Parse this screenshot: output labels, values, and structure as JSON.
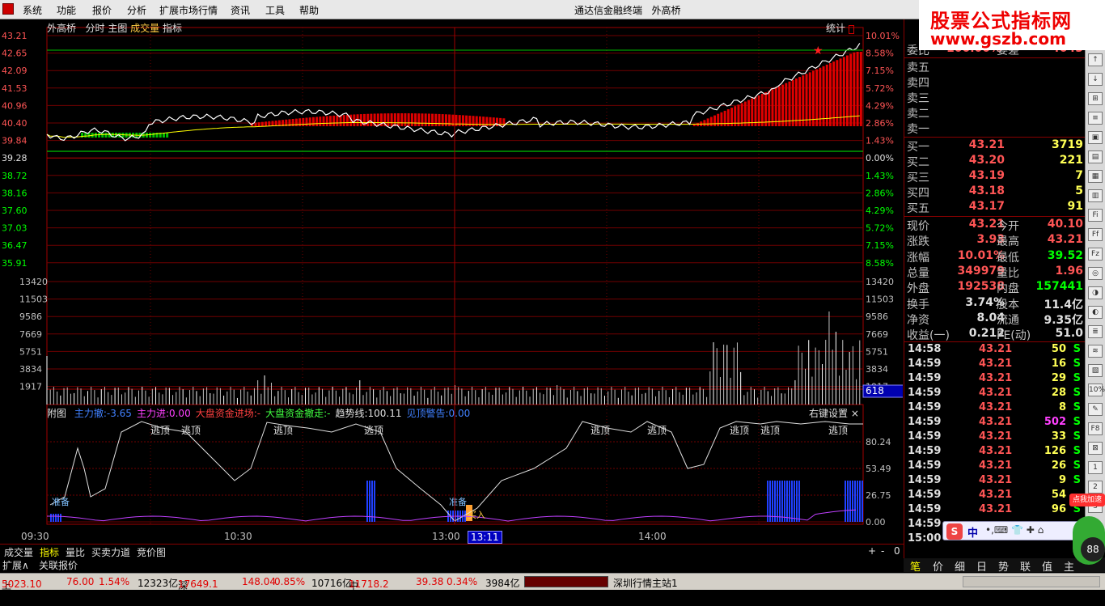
{
  "menubar": {
    "items": [
      "系统",
      "功能",
      "报价",
      "分析",
      "扩展市场行情",
      "资讯",
      "工具",
      "帮助"
    ],
    "window_title": "通达信金融终端",
    "stock_name": "外高桥"
  },
  "watermark": {
    "line1": "股票公式指标网",
    "line2": "www.gszb.com"
  },
  "chart_header": {
    "stock": "外高桥",
    "mode": "分时",
    "tabs": [
      "主图",
      "成交量",
      "指标"
    ],
    "stat": "统计"
  },
  "price_axis_left": [
    "43.21",
    "42.65",
    "42.09",
    "41.53",
    "40.96",
    "40.40",
    "39.84",
    "39.28",
    "38.72",
    "38.16",
    "37.60",
    "37.03",
    "36.47",
    "35.91"
  ],
  "pct_axis_right": [
    "10.01%",
    "8.58%",
    "7.15%",
    "5.72%",
    "4.29%",
    "2.86%",
    "1.43%",
    "0.00%",
    "1.43%",
    "2.86%",
    "4.29%",
    "5.72%",
    "7.15%",
    "8.58%"
  ],
  "vol_axis": [
    "13420",
    "11503",
    "9586",
    "7669",
    "5751",
    "3834",
    "1917"
  ],
  "vol_current": "618",
  "sub_chart": {
    "label": "附图",
    "items": [
      {
        "name": "主力撤",
        "value": "-3.65",
        "color": "#4080ff"
      },
      {
        "name": "主力进",
        "value": "0.00",
        "color": "#ff40ff"
      },
      {
        "name": "大盘资金进场",
        "value": "-",
        "color": "#ff4040"
      },
      {
        "name": "大盘资金撤走",
        "value": "-",
        "color": "#40ff40"
      },
      {
        "name": "趋势线",
        "value": "100.11",
        "color": "#e0e0e0"
      },
      {
        "name": "见顶警告",
        "value": "0.00",
        "color": "#4080ff"
      }
    ],
    "settings": "右键设置",
    "axis": [
      "80.24",
      "53.49",
      "26.75",
      "0.00"
    ],
    "labels": {
      "top": "逃顶",
      "prep": "准备",
      "buy": "买入"
    }
  },
  "time_axis": {
    "labels": [
      "09:30",
      "10:30",
      "13:00",
      "14:00"
    ],
    "cursor": "13:11"
  },
  "quotes": {
    "weibi_label": "委比",
    "weibi": "100.00%",
    "weicha_label": "委差",
    "weicha": "4045",
    "sells": [
      {
        "l": "卖五"
      },
      {
        "l": "卖四"
      },
      {
        "l": "卖三"
      },
      {
        "l": "卖二"
      },
      {
        "l": "卖一"
      }
    ],
    "buys": [
      {
        "l": "买一",
        "p": "43.21",
        "v": "3719"
      },
      {
        "l": "买二",
        "p": "43.20",
        "v": "221"
      },
      {
        "l": "买三",
        "p": "43.19",
        "v": "7"
      },
      {
        "l": "买四",
        "p": "43.18",
        "v": "5"
      },
      {
        "l": "买五",
        "p": "43.17",
        "v": "91"
      }
    ],
    "stats": [
      {
        "l1": "现价",
        "v1": "43.21",
        "l2": "今开",
        "v2": "40.10",
        "c2": "#ff5555"
      },
      {
        "l1": "涨跌",
        "v1": "3.93",
        "l2": "最高",
        "v2": "43.21",
        "c2": "#ff5555"
      },
      {
        "l1": "涨幅",
        "v1": "10.01%",
        "l2": "最低",
        "v2": "39.52",
        "c2": "#00ff00"
      },
      {
        "l1": "总量",
        "v1": "349979",
        "l2": "量比",
        "v2": "1.96",
        "c2": "#ff5555"
      },
      {
        "l1": "外盘",
        "v1": "192538",
        "l2": "内盘",
        "v2": "157441",
        "c2": "#00ff00"
      },
      {
        "l1": "换手",
        "v1": "3.74%",
        "l2": "股本",
        "v2": "11.4亿",
        "c2": "#e0e0e0"
      },
      {
        "l1": "净资",
        "v1": "8.04",
        "l2": "流通",
        "v2": "9.35亿",
        "c2": "#e0e0e0"
      },
      {
        "l1": "收益(一)",
        "v1": "0.212",
        "l2": "PE(动)",
        "v2": "51.0",
        "c2": "#e0e0e0"
      }
    ]
  },
  "ticks": [
    {
      "t": "14:58",
      "p": "43.21",
      "v": "50",
      "bs": "S"
    },
    {
      "t": "14:59",
      "p": "43.21",
      "v": "16",
      "bs": "S"
    },
    {
      "t": "14:59",
      "p": "43.21",
      "v": "29",
      "bs": "S"
    },
    {
      "t": "14:59",
      "p": "43.21",
      "v": "28",
      "bs": "S"
    },
    {
      "t": "14:59",
      "p": "43.21",
      "v": "8",
      "bs": "S"
    },
    {
      "t": "14:59",
      "p": "43.21",
      "v": "502",
      "bs": "S"
    },
    {
      "t": "14:59",
      "p": "43.21",
      "v": "33",
      "bs": "S"
    },
    {
      "t": "14:59",
      "p": "43.21",
      "v": "126",
      "bs": "S"
    },
    {
      "t": "14:59",
      "p": "43.21",
      "v": "26",
      "bs": "S"
    },
    {
      "t": "14:59",
      "p": "43.21",
      "v": "9",
      "bs": "S"
    },
    {
      "t": "14:59",
      "p": "43.21",
      "v": "54",
      "bs": ""
    },
    {
      "t": "14:59",
      "p": "43.21",
      "v": "96",
      "bs": "S"
    },
    {
      "t": "14:59",
      "p": "",
      "v": "",
      "bs": ""
    },
    {
      "t": "15:00",
      "p": "",
      "v": "",
      "bs": ""
    }
  ],
  "bottom_tabs": [
    "成交量",
    "指标",
    "量比",
    "买卖力道",
    "竞价图"
  ],
  "bottom_tabs2": [
    "扩展∧",
    "关联报价"
  ],
  "right_tabs": [
    "笔",
    "价",
    "细",
    "日",
    "势",
    "联",
    "值",
    "主"
  ],
  "ime": {
    "s": "S",
    "z": "中"
  },
  "bubble": {
    "text": "点我加速",
    "num": "88"
  },
  "status": {
    "sh_label": "上证",
    "sh": "5023.10",
    "sh_chg": "76.00",
    "sh_pct": "1.54%",
    "sh_amt": "12323亿",
    "sz_label": "深证",
    "sz": "17649.1",
    "sz_chg": "148.04",
    "sz_pct": "0.85%",
    "sz_amt": "10716亿",
    "zx_label": "中小",
    "zx": "11718.2",
    "zx_chg": "39.38",
    "zx_pct": "0.34%",
    "zx_amt": "3984亿",
    "server": "深圳行情主站1"
  },
  "toolbar_right": [
    "↑",
    "↓",
    "⊞",
    "≡",
    "▣",
    "▤",
    "▦",
    "▥",
    "Fi",
    "Ff",
    "Fz",
    "◎",
    "◑",
    "◐",
    "≣",
    "≋",
    "▧",
    "10%",
    "✎",
    "F8",
    "⊠",
    "1",
    "2",
    "3"
  ]
}
